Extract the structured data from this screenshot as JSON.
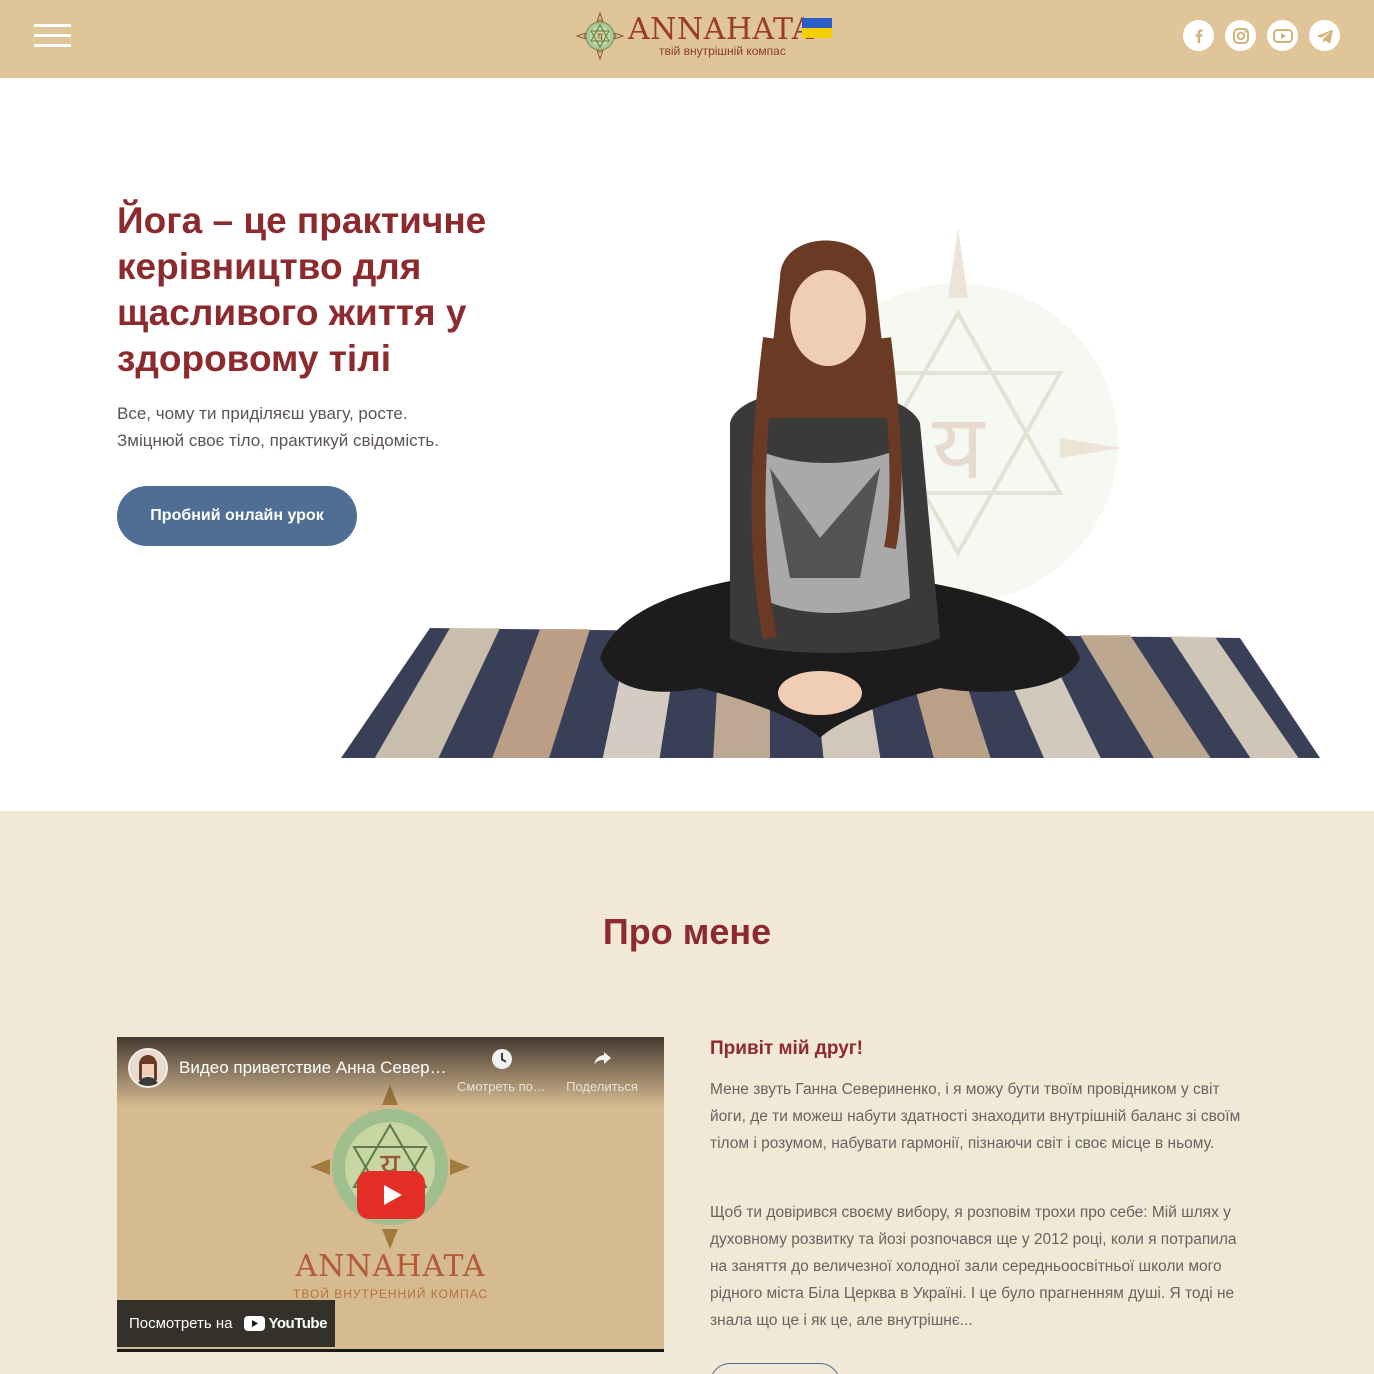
{
  "header": {
    "logo": {
      "word": "ANNAHATA",
      "subtitle": "твій внутрішній компас"
    },
    "flag": {
      "top_color": "#2a5fc8",
      "bottom_color": "#f4d000"
    },
    "socials": [
      "facebook-icon",
      "instagram-icon",
      "youtube-icon",
      "telegram-icon"
    ],
    "brand_color": "#e0c598"
  },
  "hero": {
    "title": "Йога – це практичне керівництво для щасливого життя у здоровому тілі",
    "subtitle_line1": "Все, чому ти приділяєш увагу, росте.",
    "subtitle_line2": "Зміцнюй своє тіло, практикуй свідомість.",
    "cta_label": "Пробний онлайн урок",
    "accent": "#8c2a2e",
    "button_color": "#4e6f93"
  },
  "about": {
    "title": "Про мене",
    "video": {
      "title": "Видео приветствие Анна Севериненко",
      "watch_later": "Смотреть позже",
      "share": "Поделиться",
      "logo_word": "ANNAHATA",
      "logo_sub": "ТВОЙ ВНУТРЕННИЙ КОМПАС",
      "watch_on": "Посмотреть на",
      "brand": "YouTube"
    },
    "greeting": "Привіт мій друг!",
    "paragraph1": "Мене звуть Ганна Севериненко, і я можу бути твоїм провідником у світ йоги, де ти можеш набути здатності знаходити внутрішній баланс зі своїм тілом і розумом, набувати гармонії, пізнаючи світ і своє місце в ньому.",
    "paragraph2": "Щоб ти довірився своєму вибору, я розповім трохи про себе: Мій шлях у духовному розвитку та йозі розпочався ще у 2012 році, коли я потрапила на заняття до величезної холодної зали середньоосвітньої школи мого рідного міста Біла Церква в Україні. І це було прагненням душі. Я тоді не знала що це і як це, але внутрішнє...",
    "background": "#f1e8d6"
  }
}
